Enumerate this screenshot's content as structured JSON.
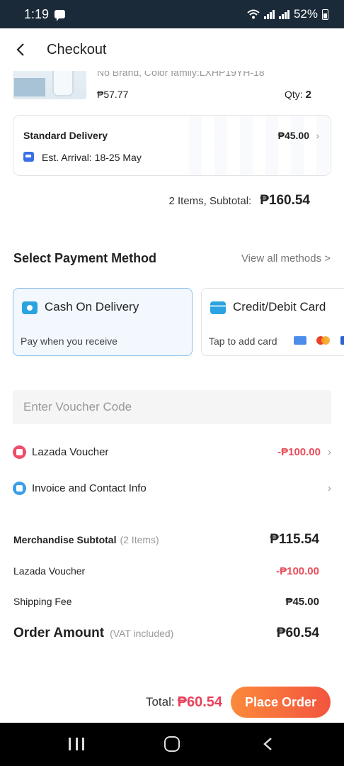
{
  "status_bar": {
    "time": "1:19",
    "battery": "52%"
  },
  "header": {
    "title": "Checkout"
  },
  "product": {
    "variant": "No Brand, Color family:LXHP19YH-18",
    "price": "₱57.77",
    "qty_label": "Qty:",
    "qty_value": "2"
  },
  "delivery": {
    "name": "Standard Delivery",
    "fee": "₱45.00",
    "eta": "Est. Arrival: 18-25 May"
  },
  "subtotal": {
    "label": "2 Items, Subtotal:",
    "value": "₱160.54"
  },
  "payment": {
    "title": "Select Payment Method",
    "view_all": "View all methods >",
    "methods": [
      {
        "name": "Cash On Delivery",
        "desc": "Pay when you receive",
        "selected": true
      },
      {
        "name": "Credit/Debit Card",
        "desc": "Tap to add card",
        "selected": false
      }
    ]
  },
  "voucher": {
    "placeholder": "Enter Voucher Code",
    "lazada_label": "Lazada Voucher",
    "lazada_value": "-₱100.00",
    "invoice_label": "Invoice and Contact Info"
  },
  "summary": {
    "merch_label": "Merchandise Subtotal",
    "merch_note": "(2 Items)",
    "merch_value": "₱115.54",
    "voucher_label": "Lazada Voucher",
    "voucher_value": "-₱100.00",
    "shipping_label": "Shipping Fee",
    "shipping_value": "₱45.00",
    "order_label": "Order Amount",
    "order_note": "(VAT included)",
    "order_value": "₱60.54"
  },
  "footer": {
    "total_label": "Total:",
    "total_value": "₱60.54",
    "place_order": "Place Order"
  },
  "colors": {
    "accent_red": "#e94c5b",
    "button_gradient_start": "#fb8a3b",
    "button_gradient_end": "#f3543f",
    "selected_border": "#8ec1ea"
  }
}
